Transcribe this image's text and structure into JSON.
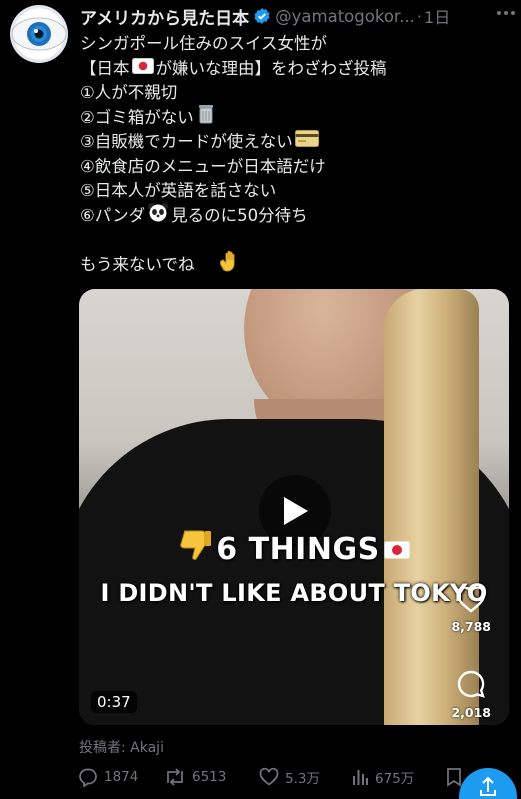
{
  "colors": {
    "background": "#000000",
    "text": "#e7e9ea",
    "muted": "#71767b",
    "accent": "#1d9bf0"
  },
  "header": {
    "display_name": "アメリカから見た日本",
    "handle": "@yamatogokor...",
    "separator": "·",
    "time": "1日",
    "verified_icon": "verified-badge-icon",
    "more_icon": "more-dots-icon"
  },
  "tweet": {
    "line1": "シンガポール住みのスイス女性が",
    "line2_a": "【日本",
    "line2_b": "が嫌いな理由】をわざわざ投稿",
    "item1": "①人が不親切",
    "item2": "②ゴミ箱がない",
    "item3": "③自販機でカードが使えない",
    "item4": "④飲食店のメニューが日本語だけ",
    "item5": "⑤日本人が英語を話さない",
    "item6_a": "⑥パンダ",
    "item6_b": "見るのに50分待ち",
    "closing": "もう来ないでね",
    "emojis": [
      "japan-flag-icon",
      "trash-can-icon",
      "credit-card-icon",
      "panda-icon",
      "waving-hand-icon"
    ]
  },
  "media": {
    "overlay_title": "6 THINGS",
    "overlay_subtitle": "I DIDN'T LIKE ABOUT TOKYO",
    "like_count": "8,788",
    "comment_count": "2,018",
    "duration": "0:37",
    "play_icon": "play-icon"
  },
  "attribution": "投稿者: Akaji",
  "actions": {
    "replies": "1874",
    "retweets": "6513",
    "likes": "5.3万",
    "views": "675万"
  }
}
